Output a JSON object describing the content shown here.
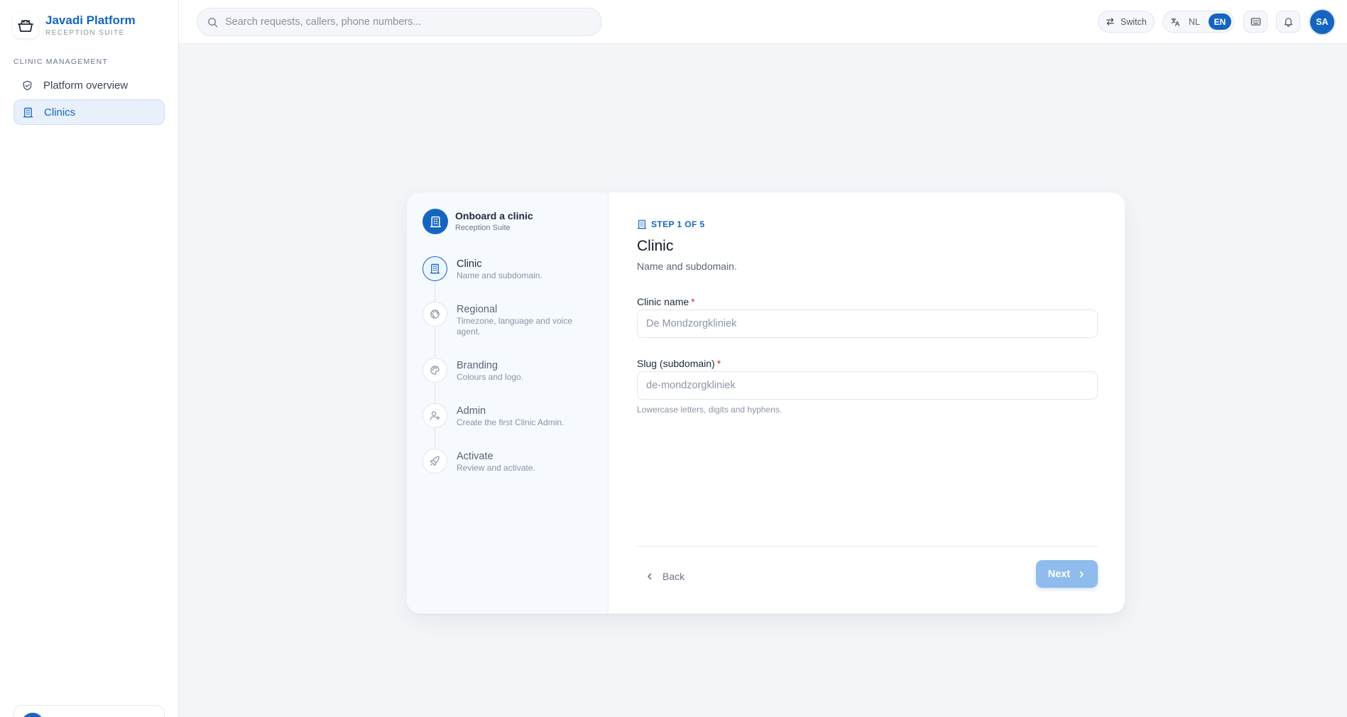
{
  "brand": {
    "name": "Javadi Platform",
    "subtitle": "RECEPTION SUITE",
    "logo_icon": "reception-desk-icon"
  },
  "sidebar": {
    "section_label": "CLINIC MANAGEMENT",
    "items": [
      {
        "label": "Platform overview",
        "icon": "shield-check-icon",
        "active": false
      },
      {
        "label": "Clinics",
        "icon": "building-icon",
        "active": true
      }
    ]
  },
  "topbar": {
    "search_placeholder": "Search requests, callers, phone numbers...",
    "switch_label": "Switch",
    "languages": {
      "nl": "NL",
      "en": "EN",
      "active": "EN"
    },
    "avatar_initials": "SA"
  },
  "wizard": {
    "title": "Onboard a clinic",
    "subtitle": "Reception Suite",
    "steps": [
      {
        "name": "Clinic",
        "desc": "Name and subdomain.",
        "icon": "building-icon",
        "current": true
      },
      {
        "name": "Regional",
        "desc": "Timezone, language and voice agent.",
        "icon": "globe-icon",
        "current": false
      },
      {
        "name": "Branding",
        "desc": "Colours and logo.",
        "icon": "palette-icon",
        "current": false
      },
      {
        "name": "Admin",
        "desc": "Create the first Clinic Admin.",
        "icon": "user-plus-icon",
        "current": false
      },
      {
        "name": "Activate",
        "desc": "Review and activate.",
        "icon": "rocket-icon",
        "current": false
      }
    ]
  },
  "form": {
    "step_indicator": "STEP 1 OF 5",
    "title": "Clinic",
    "subtitle": "Name and subdomain.",
    "clinic_name_label": "Clinic name",
    "clinic_name_placeholder": "De Mondzorgkliniek",
    "slug_label": "Slug (subdomain)",
    "slug_placeholder": "de-mondzorgkliniek",
    "slug_hint": "Lowercase letters, digits and hyphens.",
    "required_mark": "*",
    "back_label": "Back",
    "next_label": "Next"
  },
  "colors": {
    "accent": "#1565c0",
    "required": "#dc2626",
    "next_disabled": "#8fbcec"
  }
}
